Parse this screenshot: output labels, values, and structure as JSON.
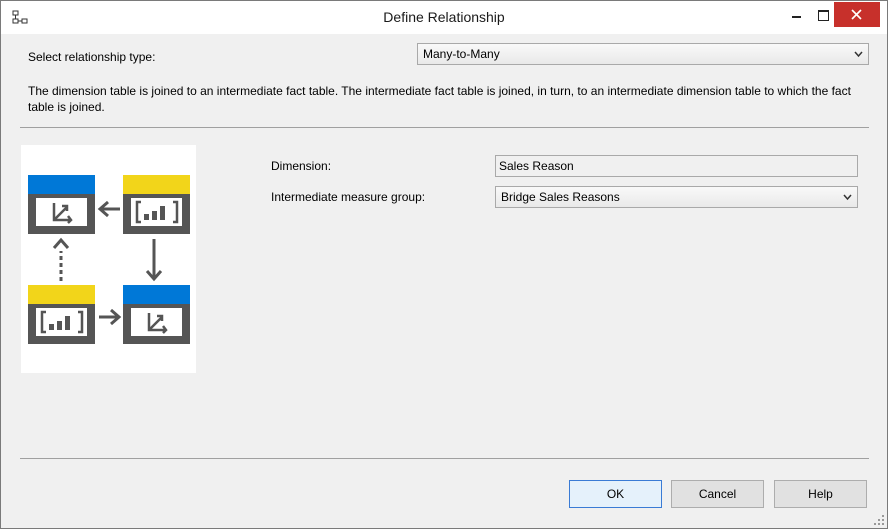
{
  "window": {
    "title": "Define Relationship"
  },
  "relationship": {
    "type_label": "Select relationship type:",
    "type_value": "Many-to-Many",
    "description": "The dimension table is joined to an intermediate fact table. The intermediate fact table is joined, in turn, to an intermediate dimension table to which the fact table is joined."
  },
  "fields": {
    "dimension_label": "Dimension:",
    "dimension_value": "Sales Reason",
    "measure_group_label": "Intermediate measure group:",
    "measure_group_value": "Bridge Sales Reasons"
  },
  "buttons": {
    "ok": "OK",
    "cancel": "Cancel",
    "help": "Help"
  },
  "icons": {
    "app": "relationship-icon",
    "diagram": "many-to-many-diagram",
    "accent_blue": "#0078d7",
    "accent_yellow": "#f2d51a",
    "icon_gray": "#555555"
  }
}
